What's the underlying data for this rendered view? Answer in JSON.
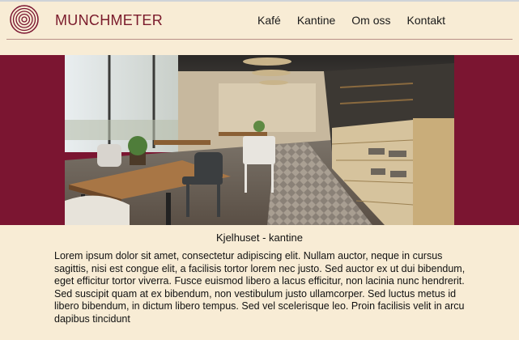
{
  "header": {
    "brand": "MUNCHMETER",
    "nav": [
      "Kafé",
      "Kantine",
      "Om oss",
      "Kontakt"
    ]
  },
  "hero": {
    "caption": "Kjelhuset - kantine"
  },
  "main": {
    "paragraph": "Lorem ipsum dolor sit amet, consectetur adipiscing elit. Nullam auctor, neque in cursus sagittis, nisi est congue elit, a facilisis tortor lorem nec justo. Sed auctor ex ut dui bibendum, eget efficitur tortor viverra. Fusce euismod libero a lacus efficitur, non lacinia nunc hendrerit. Sed suscipit quam at ex bibendum, non vestibulum justo ullamcorper. Sed luctus metus id libero bibendum, in dictum libero tempus. Sed vel scelerisque leo. Proin facilisis velit in arcu dapibus tincidunt"
  },
  "colors": {
    "background": "#f8ecd5",
    "accent": "#7b1531",
    "brand_text": "#7a1a2b"
  },
  "icons": {
    "logo": "concentric-circles-logo-icon"
  }
}
